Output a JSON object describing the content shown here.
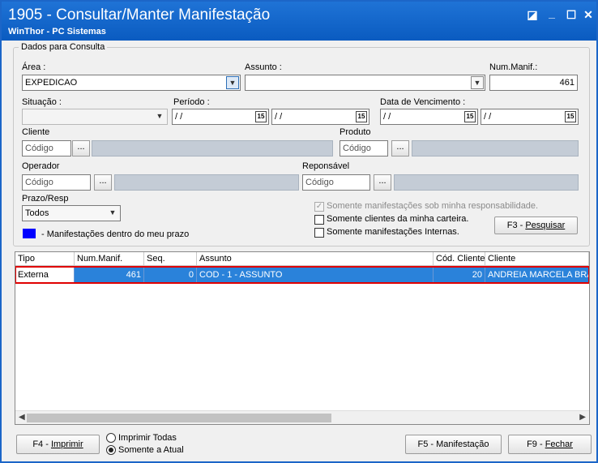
{
  "window": {
    "title": "1905 - Consultar/Manter Manifestação",
    "subtitle": "WinThor - PC Sistemas",
    "controls": {
      "restore": "◪",
      "minimize": "_",
      "maximize": "☐",
      "close": "✕"
    }
  },
  "consulta": {
    "legend": "Dados para Consulta",
    "area": {
      "label": "Área :",
      "value": "EXPEDICAO"
    },
    "assunto": {
      "label": "Assunto :",
      "value": ""
    },
    "num_manif": {
      "label": "Num.Manif.:",
      "value": "461"
    },
    "situacao": {
      "label": "Situação :",
      "value": ""
    },
    "periodo": {
      "label": "Período :",
      "start": " / /",
      "end": " / /"
    },
    "vencimento": {
      "label": "Data de Vencimento :",
      "start": " / /",
      "end": " / /"
    },
    "cliente": {
      "label": "Cliente",
      "placeholder": "Código"
    },
    "produto": {
      "label": "Produto",
      "placeholder": "Código"
    },
    "operador": {
      "label": "Operador",
      "placeholder": "Código"
    },
    "responsavel": {
      "label": "Reponsável",
      "placeholder": "Código"
    },
    "prazo": {
      "label": "Prazo/Resp",
      "value": "Todos"
    },
    "ellipsis": "...",
    "calendar_icon": "15",
    "legend_text": "- Manifestações dentro do meu prazo",
    "legend_color": "#0000ff",
    "checks": {
      "responsabilidade": "Somente manifestações sob minha responsabilidade.",
      "carteira": "Somente clientes da minha carteira.",
      "internas": "Somente manifestações Internas."
    },
    "pesquisar": {
      "key": "F3 - ",
      "label": "Pesquisar"
    }
  },
  "grid": {
    "columns": [
      "Tipo",
      "Num.Manif.",
      "Seq.",
      "Assunto",
      "Cód. Cliente",
      "Cliente"
    ],
    "rows": [
      {
        "tipo": "Externa",
        "num": "461",
        "seq": "0",
        "assunto": "COD - 1 - ASSUNTO",
        "cod_cliente": "20",
        "cliente": "ANDREIA MARCELA BRAG"
      }
    ],
    "selected_color": "#2a82da"
  },
  "footer": {
    "imprimir": {
      "key": "F4 - ",
      "label": "Imprimir"
    },
    "radio_todas": "Imprimir Todas",
    "radio_atual": "Somente a Atual",
    "manifestacao": "F5 - Manifestação",
    "fechar": {
      "key": "F9 - ",
      "label": "Fechar"
    }
  }
}
